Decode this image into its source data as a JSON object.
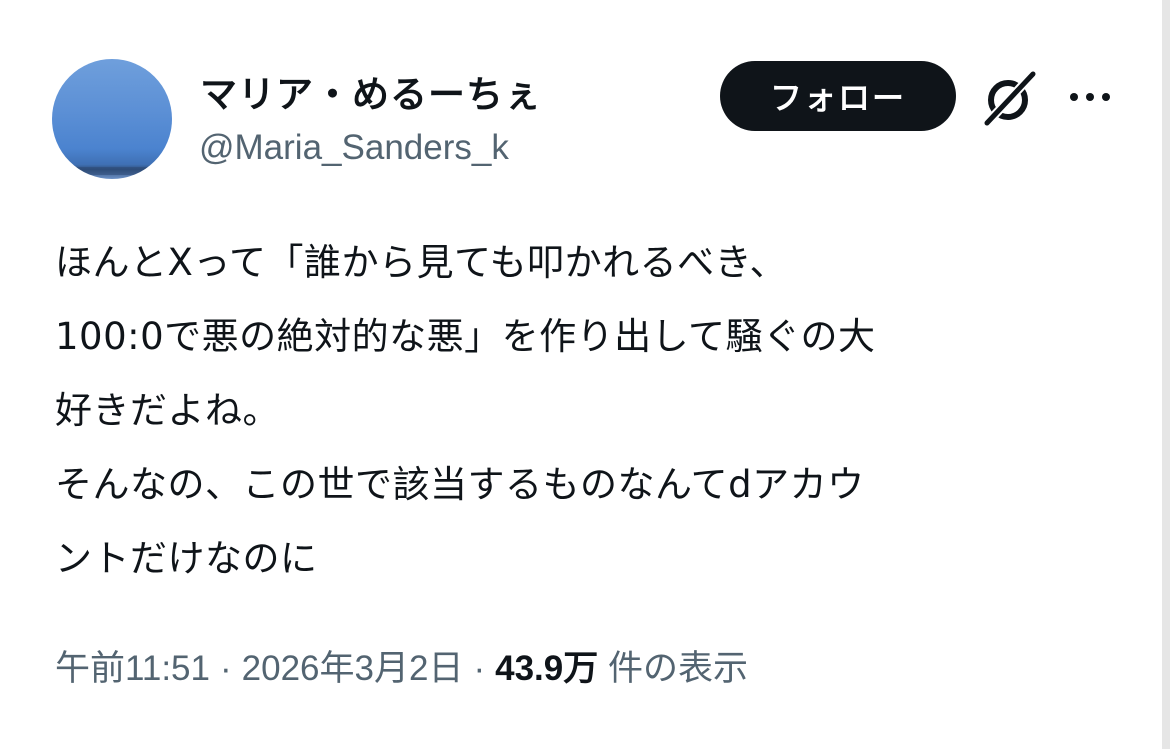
{
  "user": {
    "display_name": "マリア・めるーちぇ",
    "handle": "@Maria_Sanders_k"
  },
  "actions": {
    "follow_label": "フォロー",
    "grok_icon": "grok-icon",
    "more_icon": "more-icon"
  },
  "tweet": {
    "lines": [
      "ほんとXって「誰から見ても叩かれるべき、",
      "100:0で悪の絶対的な悪」を作り出して騒ぐの大",
      "好きだよね。",
      "そんなの、この世で該当するものなんてdアカウ",
      "ントだけなのに"
    ]
  },
  "meta": {
    "time": "午前11:51",
    "separator": "·",
    "date": "2026年3月2日",
    "views_count": "43.9万",
    "views_label": "件の表示"
  },
  "colors": {
    "text": "#0f1419",
    "secondary": "#536471",
    "button_bg": "#0f1419",
    "button_text": "#ffffff"
  }
}
